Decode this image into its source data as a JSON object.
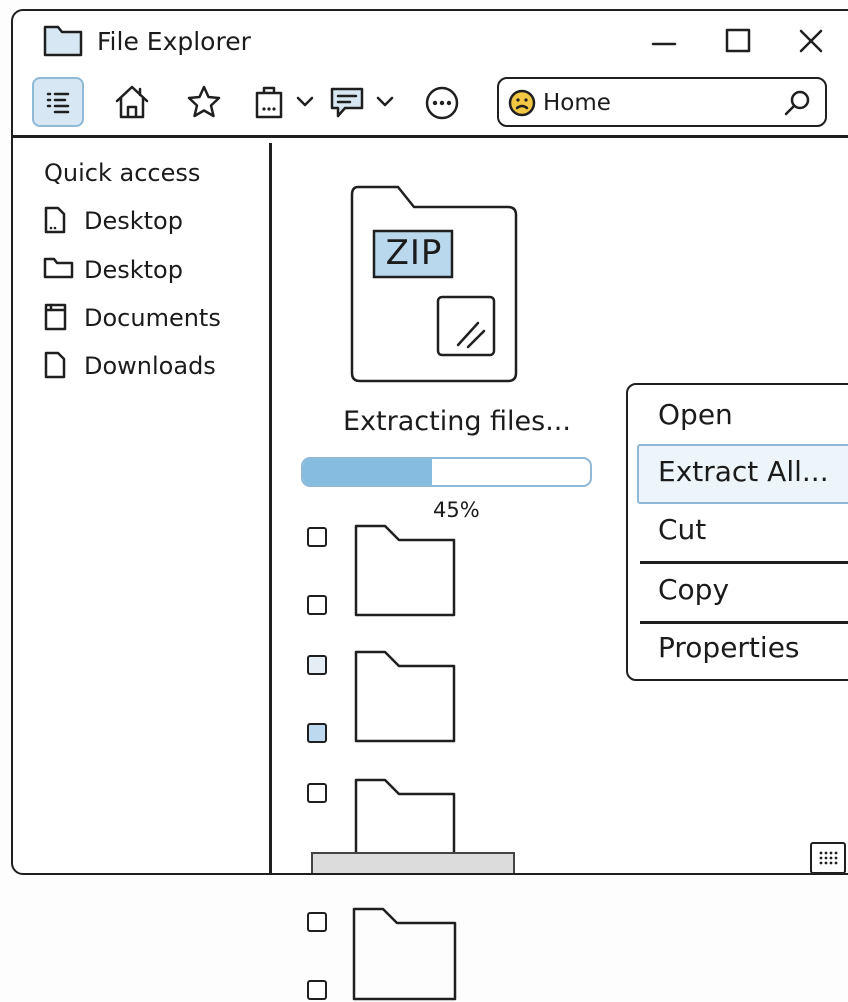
{
  "window": {
    "title": "File Explorer",
    "controls": [
      "minimize",
      "maximize",
      "close"
    ]
  },
  "toolbar": {
    "buttons": [
      {
        "name": "view-toggle",
        "icon": "list-icon",
        "active": true
      },
      {
        "name": "home",
        "icon": "home-icon"
      },
      {
        "name": "favorites",
        "icon": "star-icon"
      },
      {
        "name": "clipboard",
        "icon": "clipboard-icon",
        "dropdown": true
      },
      {
        "name": "comments",
        "icon": "comment-icon",
        "dropdown": true
      },
      {
        "name": "more",
        "icon": "more-icon"
      }
    ],
    "search": {
      "location_icon": "user-face-icon",
      "value": "Home",
      "search_icon": "magnifier-icon"
    }
  },
  "sidebar": {
    "heading": "Quick access",
    "items": [
      {
        "label": "Desktop",
        "icon": "file-icon"
      },
      {
        "label": "Desktop",
        "icon": "folder-icon"
      },
      {
        "label": "Documents",
        "icon": "document-icon"
      },
      {
        "label": "Downloads",
        "icon": "file-icon"
      }
    ]
  },
  "main": {
    "archive": {
      "label": "ZIP",
      "icon": "zip-file-icon"
    },
    "status": "Extracting files...",
    "progress": {
      "value": 0.45,
      "label": "45%"
    },
    "checkbox_states": [
      "unchecked",
      "unchecked",
      "partial",
      "checked",
      "unchecked",
      "unchecked",
      "unchecked"
    ]
  },
  "context_menu": {
    "items": [
      "Open",
      "Extract All...",
      "Cut",
      "Copy",
      "Properties"
    ],
    "highlighted_index": 1
  },
  "colors": {
    "accent": "#85bce0",
    "accent_border": "#8fb9d6",
    "highlight_bg": "#d7e8f4",
    "outline": "#1f1f1f",
    "smiley": "#f2c744"
  }
}
